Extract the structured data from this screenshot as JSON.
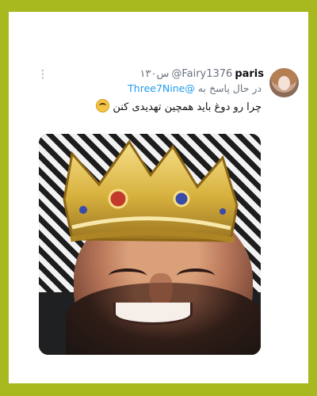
{
  "tweet": {
    "author_name": "paris",
    "handle": "@Fairy1376",
    "time": "۱۳۰س",
    "reply_prefix": "در حال پاسخ به",
    "reply_mention": "@Three7Nine",
    "text": "چرا رو دوغ باید همچین تهدیدی کنن",
    "emoji": "laughing-face-icon",
    "more_icon": "more-options-icon"
  },
  "media": {
    "subject": "man-wearing-gold-crown-photo"
  },
  "colors": {
    "background": "#a8b81f",
    "card": "#ffffff",
    "text": "#111111",
    "muted": "#6b7280",
    "link": "#1d9bf0",
    "crown_gold": "#d7b13d"
  }
}
